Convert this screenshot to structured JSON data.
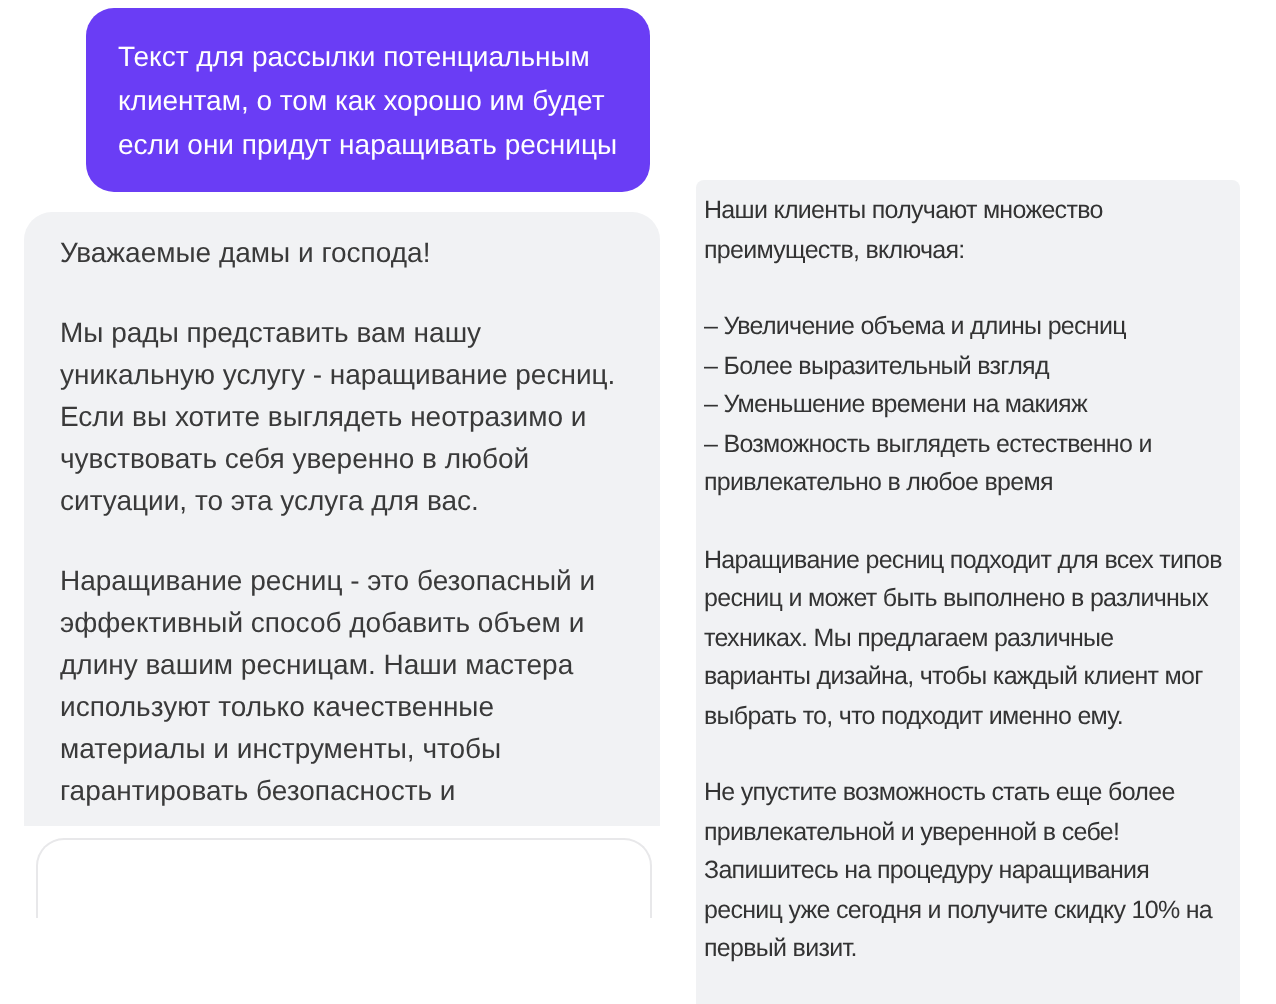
{
  "prompt": {
    "text": "Текст для рассылки потенциальным клиентам, о том как хорошо им будет если они придут наращивать ресницы"
  },
  "responses": [
    {
      "cut": true,
      "blocks": [
        {
          "kind": "paragraph",
          "text": "Уважаемые дамы и господа!"
        },
        {
          "kind": "paragraph",
          "text": "Мы рады представить вам нашу уникальную услугу - наращивание ресниц. Если вы хотите выглядеть неотразимо и чувствовать себя уверенно в любой ситуации, то эта услуга для вас."
        },
        {
          "kind": "paragraph",
          "text": "Наращивание ресниц - это безопасный и эффективный способ добавить объем и длину вашим ресницам. Наши мастера используют только качественные материалы и инструменты, чтобы гарантировать безопасность и"
        }
      ]
    },
    {
      "cut": false,
      "blocks": [
        {
          "kind": "paragraph",
          "text": "Наши клиенты получают множество преимуществ, включая:"
        },
        {
          "kind": "list",
          "items": [
            "– Увеличение объема и длины ресниц",
            "– Более выразительный взгляд",
            "– Уменьшение времени на макияж",
            "– Возможность выглядеть естественно и привлекательно в любое время"
          ]
        },
        {
          "kind": "paragraph",
          "text": "Наращивание ресниц подходит для всех типов ресниц и может быть выполнено в различных техниках. Мы предлагаем различные варианты дизайна, чтобы каждый клиент мог выбрать то, что подходит именно ему."
        },
        {
          "kind": "paragraph",
          "text": "Не упустите возможность стать еще более привлекательной и уверенной в себе! Запишитесь на процедуру наращивания ресниц уже сегодня и получите скидку 10% на первый визит."
        }
      ]
    }
  ]
}
